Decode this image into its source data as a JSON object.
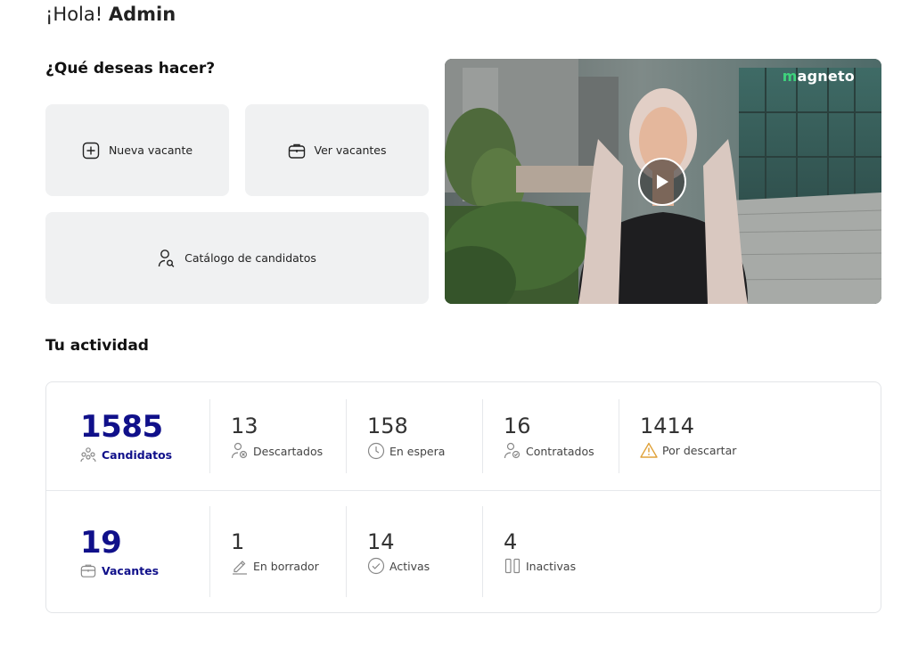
{
  "greeting": {
    "prefix": "¡Hola!",
    "name": "Admin"
  },
  "actions": {
    "title": "¿Qué deseas hacer?",
    "new_vacancy": "Nueva vacante",
    "view_vacancies": "Ver vacantes",
    "candidate_catalog": "Catálogo de candidatos"
  },
  "video": {
    "brand_first": "m",
    "brand_rest": "agneto"
  },
  "activity": {
    "title": "Tu actividad",
    "candidates": {
      "total": "1585",
      "total_label": "Candidatos",
      "discarded": "13",
      "discarded_label": "Descartados",
      "waiting": "158",
      "waiting_label": "En espera",
      "hired": "16",
      "hired_label": "Contratados",
      "to_discard": "1414",
      "to_discard_label": "Por descartar"
    },
    "vacancies": {
      "total": "19",
      "total_label": "Vacantes",
      "draft": "1",
      "draft_label": "En borrador",
      "active": "14",
      "active_label": "Activas",
      "inactive": "4",
      "inactive_label": "Inactivas"
    }
  },
  "colors": {
    "accent": "#10108a",
    "card_bg": "#f0f1f2",
    "warning": "#e0a23a"
  }
}
